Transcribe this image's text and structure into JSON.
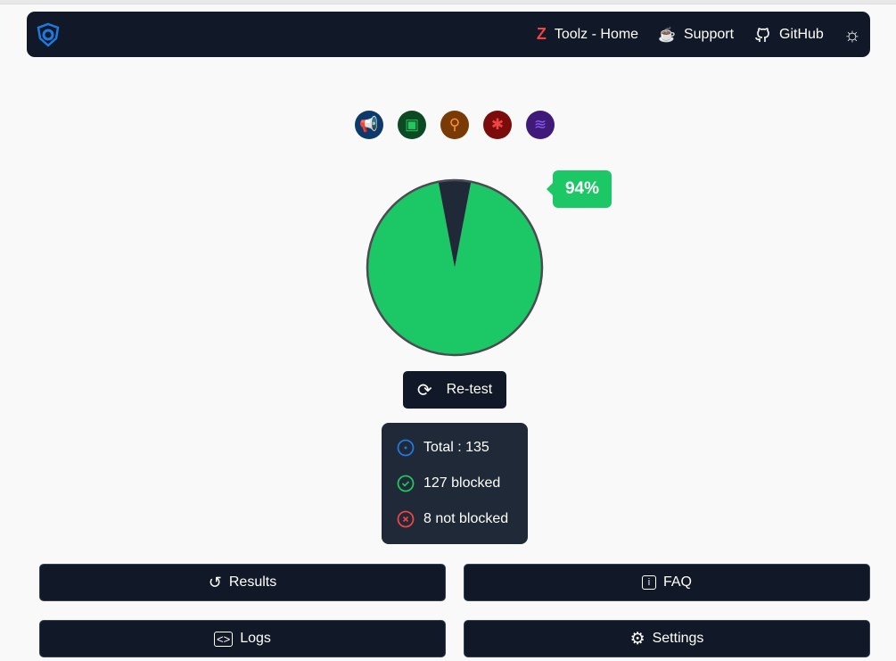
{
  "nav": {
    "links": [
      {
        "label": "Toolz - Home",
        "icon": "toolz-logo-icon"
      },
      {
        "label": "Support",
        "icon": "coffee-icon"
      },
      {
        "label": "GitHub",
        "icon": "github-icon"
      }
    ],
    "theme_icon": "sun-icon"
  },
  "tool_icons": [
    {
      "name": "megaphone-icon",
      "bg": "#0c3a6b",
      "fg": "#1e7ae0"
    },
    {
      "name": "chart-icon",
      "bg": "#0c4a23",
      "fg": "#22c55e"
    },
    {
      "name": "network-icon",
      "bg": "#7a3a06",
      "fg": "#fb923c"
    },
    {
      "name": "bug-icon",
      "bg": "#7a0c0c",
      "fg": "#ef4444"
    },
    {
      "name": "layers-icon",
      "bg": "#3f1a78",
      "fg": "#8b5cf6"
    }
  ],
  "chart_data": {
    "type": "pie",
    "values": [
      94,
      6
    ],
    "colors": [
      "#1cc765",
      "#1f2937"
    ],
    "label": "94%"
  },
  "retest_label": "Re-test",
  "stats": {
    "total": "Total : 135",
    "blocked": "127 blocked",
    "not_blocked": "8 not blocked"
  },
  "buttons": {
    "results": "Results",
    "faq": "FAQ",
    "logs": "Logs",
    "settings": "Settings"
  }
}
